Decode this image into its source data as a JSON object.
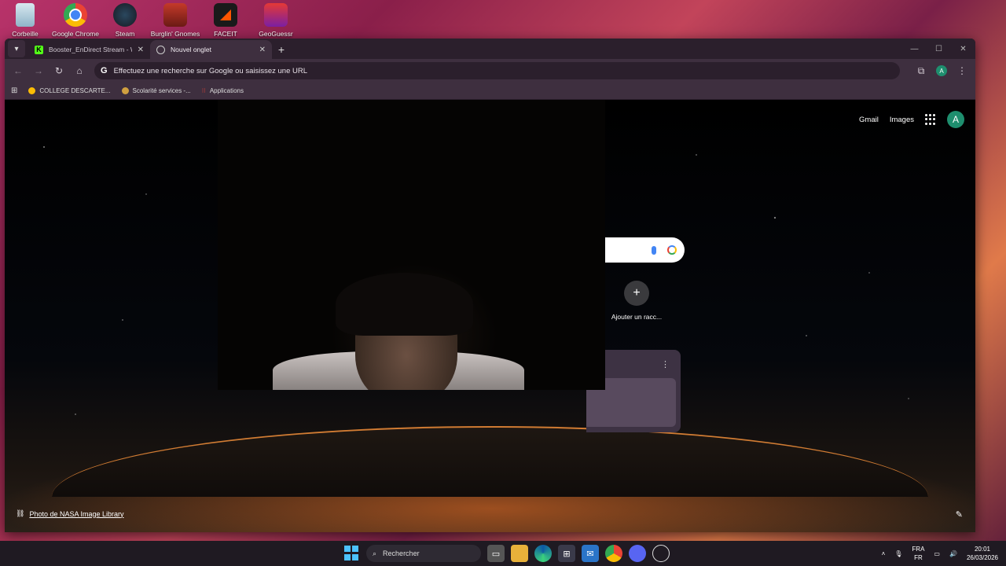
{
  "desktop": {
    "icons": [
      {
        "label": "Corbeille",
        "icon": "recycle-bin-icon"
      },
      {
        "label": "Google Chrome",
        "icon": "chrome-icon"
      },
      {
        "label": "Steam",
        "icon": "steam-icon"
      },
      {
        "label": "Burglin' Gnomes",
        "icon": "game-icon"
      },
      {
        "label": "FACEIT",
        "icon": "faceit-icon"
      },
      {
        "label": "GeoGuessr Steam",
        "icon": "geoguessr-icon"
      }
    ]
  },
  "browser": {
    "tabs": [
      {
        "title": "Booster_EnDirect Stream - Watc",
        "favicon": "K",
        "favicon_color": "#53fc18"
      },
      {
        "title": "Nouvel onglet",
        "favicon": "chrome-icon",
        "active": true
      }
    ],
    "omnibox": {
      "placeholder": "Effectuez une recherche sur Google ou saisissez une URL",
      "icon": "G"
    },
    "profile_initial": "A",
    "bookmarks": [
      {
        "label": "COLLEGE DESCARTE...",
        "color": "#fbbc05"
      },
      {
        "label": "Scolarité services -...",
        "color": "#d0a040"
      },
      {
        "label": "Applications",
        "color": "#ea4335"
      }
    ]
  },
  "ntp": {
    "links": {
      "gmail": "Gmail",
      "images": "Images"
    },
    "profile_initial": "A",
    "shortcut": {
      "symbol": "+",
      "label": "Ajouter un racc..."
    },
    "card_menu": "⋮",
    "credit": "Photo de NASA Image Library",
    "edit_icon": "✎"
  },
  "taskbar": {
    "search_label": "Rechercher",
    "language": {
      "line1": "FRA",
      "line2": "FR"
    },
    "time": "20:01",
    "date": "26/03/2026"
  },
  "colors": {
    "accent": "#1e8e6e",
    "chrome_frame": "#3e2f3f",
    "chrome_tabstrip": "#2b1f2c"
  }
}
